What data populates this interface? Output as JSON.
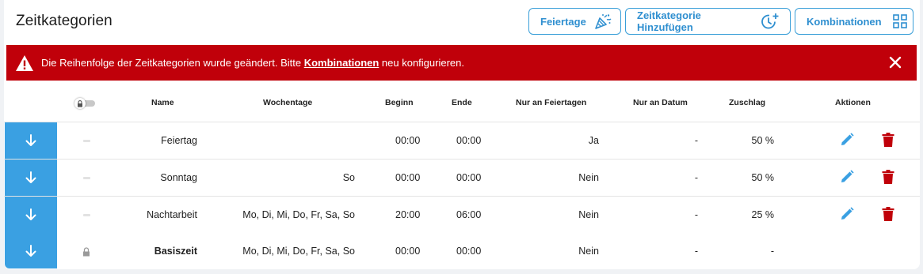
{
  "page": {
    "title": "Zeitkategorien"
  },
  "toolbar": {
    "holidays_label": "Feiertage",
    "add_label": "Zeitkategorie Hinzufügen",
    "combinations_label": "Kombinationen"
  },
  "alert": {
    "text_before": "Die Reihenfolge der Zeitkategorien wurde geändert. Bitte ",
    "link": "Kombinationen",
    "text_after": " neu konfigurieren."
  },
  "table": {
    "headers": {
      "name": "Name",
      "weekdays": "Wochentage",
      "start": "Beginn",
      "end": "Ende",
      "holidays_only": "Nur an Feiertagen",
      "date_only": "Nur an Datum",
      "surcharge": "Zuschlag",
      "actions": "Aktionen"
    },
    "rows": [
      {
        "name": "Feiertag",
        "weekdays": "",
        "start": "00:00",
        "end": "00:00",
        "holidays_only": "Ja",
        "date_only": "-",
        "surcharge": "50 %"
      },
      {
        "name": "Sonntag",
        "weekdays": "So",
        "start": "00:00",
        "end": "00:00",
        "holidays_only": "Nein",
        "date_only": "-",
        "surcharge": "50 %"
      },
      {
        "name": "Nachtarbeit",
        "weekdays": "Mo, Di, Mi, Do, Fr, Sa, So",
        "start": "20:00",
        "end": "06:00",
        "holidays_only": "Nein",
        "date_only": "-",
        "surcharge": "25 %"
      },
      {
        "name": "Basiszeit",
        "weekdays": "Mo, Di, Mi, Do, Fr, Sa, So",
        "start": "00:00",
        "end": "00:00",
        "holidays_only": "Nein",
        "date_only": "-",
        "surcharge": "-"
      }
    ]
  },
  "icons": {
    "holidays": "party-popper-icon",
    "add": "clock-plus-icon",
    "combinations": "grid-icon",
    "warning": "warning-icon",
    "close": "close-icon",
    "drag": "arrow-down-icon",
    "edit": "pencil-icon",
    "delete": "trash-icon",
    "lock": "lock-icon"
  },
  "colors": {
    "accent": "#3aa0e2",
    "alert": "#c0000a",
    "delete": "#c0000a"
  }
}
